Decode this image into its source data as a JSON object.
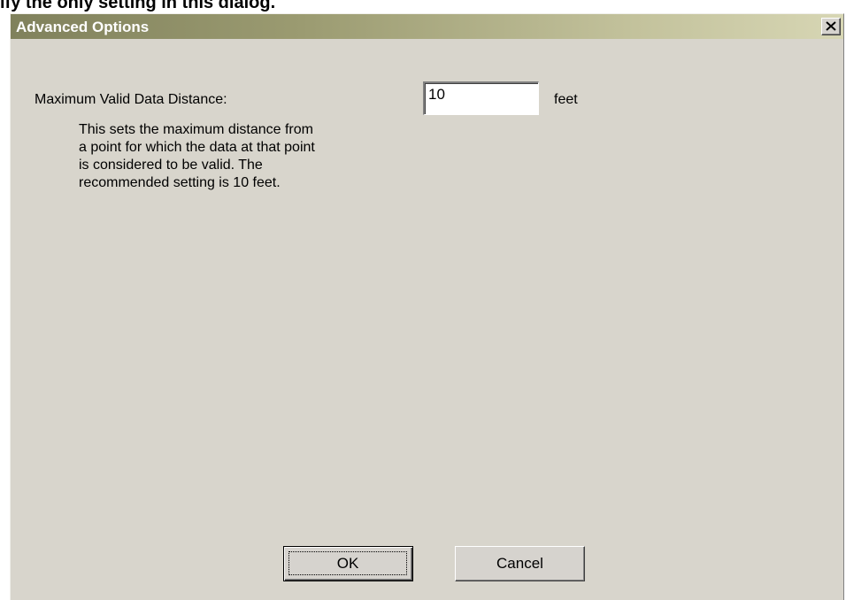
{
  "caption": "ify the only setting in this dialog.",
  "dialog": {
    "title": "Advanced Options",
    "close_icon": "close-icon",
    "field": {
      "label": "Maximum Valid Data Distance:",
      "help": "This sets the maximum distance from\na point for which the data at that point\nis considered to be valid.  The\nrecommended setting is 10 feet.",
      "value": "10",
      "unit": "feet"
    },
    "ok_label": "OK",
    "cancel_label": "Cancel"
  },
  "colors": {
    "dialog_background": "#d8d5cc",
    "title_gradient_start": "#80815c",
    "title_gradient_end": "#d7d6b4",
    "title_text": "#ffffff"
  }
}
